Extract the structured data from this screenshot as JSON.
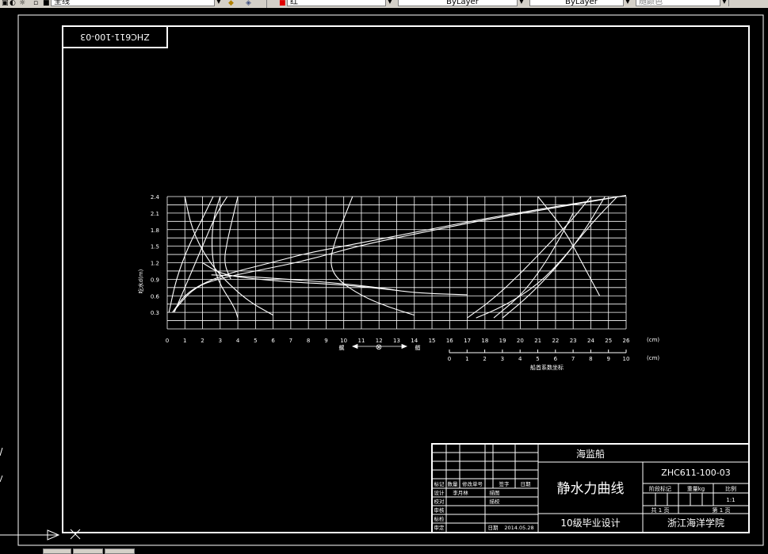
{
  "toolbar": {
    "layer_name": "全线",
    "color_name": "红",
    "linetype": "ByLayer",
    "lineweight": "ByLayer",
    "plotstyle": "随颜色"
  },
  "drawing": {
    "drawing_number_mirrored": "ZHC611-100-03",
    "chart_x_unit": "(cm)",
    "chart_x2_title": "船首系数坐标",
    "chart_y_label": "吃水d(m)",
    "left_arrow_label": "艉",
    "right_arrow_label": "艏",
    "center_symbol": "⊗",
    "title_block": {
      "ship_name": "海监船",
      "drawing_title": "静水力曲线",
      "project": "10级毕业设计",
      "drawing_number": "ZHC611-100-03",
      "school": "浙江海洋学院",
      "stage_label": "阶段标记",
      "weight_label": "重量kg",
      "scale_label": "比例",
      "scale_value": "1:1",
      "sheet_total": "共 1 页",
      "sheet_no": "第 1 页",
      "mark_label": "标记",
      "count_label": "数量",
      "change_doc_label": "修改单号",
      "sign_label": "签字",
      "date_label": "日期",
      "roles": [
        "设计",
        "校对",
        "审核",
        "标检",
        "审定"
      ],
      "designer": "李月林",
      "role_extra": [
        "描图",
        "描校"
      ],
      "date_value": "2014.05.28"
    }
  },
  "chart_data": {
    "type": "line",
    "title": "",
    "ylabel": "吃水d(m)",
    "xlabel": "(cm)",
    "x_ticks": [
      "0",
      "1",
      "2",
      "3",
      "4",
      "5",
      "6",
      "7",
      "8",
      "9",
      "10",
      "11",
      "12",
      "13",
      "14",
      "15",
      "16",
      "17",
      "18",
      "19",
      "20",
      "21",
      "22",
      "23",
      "24",
      "25",
      "26"
    ],
    "y_ticks": [
      "0.3",
      "0.6",
      "0.9",
      "1.2",
      "1.5",
      "1.8",
      "2.1",
      "2.4"
    ],
    "x2_ticks": [
      "0",
      "1",
      "2",
      "3",
      "4",
      "5",
      "6",
      "7",
      "8",
      "9",
      "10"
    ],
    "xlim": [
      0,
      26
    ],
    "ylim": [
      0,
      2.4
    ],
    "x2lim": [
      0,
      10
    ],
    "grid": true,
    "series": [
      {
        "values_x": [
          0.3,
          1.0,
          2.0,
          3.0,
          4.0,
          6.0,
          8.0,
          10.0,
          14.0,
          18.0,
          22.0,
          26.0
        ],
        "values_y": [
          0.3,
          0.62,
          0.82,
          0.95,
          1.05,
          1.21,
          1.38,
          1.5,
          1.75,
          2.0,
          2.22,
          2.42
        ]
      },
      {
        "values_x": [
          0.3,
          1.5,
          3.0,
          5.0,
          8.0,
          11.0,
          14.0,
          18.0,
          22.0,
          26.0
        ],
        "values_y": [
          0.3,
          0.75,
          0.92,
          1.05,
          1.25,
          1.52,
          1.72,
          1.98,
          2.2,
          2.42
        ]
      },
      {
        "values_x": [
          2.5,
          4.0,
          6.0,
          9.0,
          12.0,
          14.0,
          17.0
        ],
        "values_y": [
          0.98,
          0.96,
          0.92,
          0.85,
          0.75,
          0.65,
          0.62
        ]
      },
      {
        "values_x": [
          2.0,
          3.0,
          4.5,
          7.0,
          10.0,
          13.0
        ],
        "values_y": [
          1.2,
          1.0,
          0.92,
          0.85,
          0.8,
          0.7
        ]
      },
      {
        "values_x": [
          10.5,
          10.0,
          9.5,
          9.2,
          9.6,
          11.0,
          12.5,
          14.0
        ],
        "values_y": [
          2.4,
          2.0,
          1.6,
          1.2,
          0.9,
          0.6,
          0.4,
          0.25
        ]
      },
      {
        "values_x": [
          0.1,
          0.5,
          1.2,
          2.0,
          2.6
        ],
        "values_y": [
          0.3,
          0.9,
          1.5,
          2.0,
          2.4
        ]
      },
      {
        "values_x": [
          0.4,
          1.2,
          2.0,
          2.8,
          3.4
        ],
        "values_y": [
          0.3,
          0.9,
          1.5,
          2.1,
          2.4
        ]
      },
      {
        "values_x": [
          3.0,
          2.6,
          2.5,
          2.8,
          3.8,
          4.0
        ],
        "values_y": [
          2.4,
          2.0,
          1.4,
          0.9,
          0.4,
          0.2
        ]
      },
      {
        "values_x": [
          1.0,
          1.4,
          2.2,
          3.2,
          4.6,
          6.0
        ],
        "values_y": [
          2.4,
          1.8,
          1.3,
          0.9,
          0.5,
          0.25
        ]
      },
      {
        "values_x": [
          4.0,
          3.7,
          3.4,
          3.2,
          3.6
        ],
        "values_y": [
          2.4,
          2.0,
          1.6,
          1.2,
          0.9
        ]
      },
      {
        "values_x": [
          17.0,
          18.5,
          20.0,
          21.5,
          23.0,
          24.0
        ],
        "values_y": [
          0.2,
          0.55,
          1.0,
          1.5,
          2.0,
          2.4
        ]
      },
      {
        "values_x": [
          17.5,
          19.0,
          21.0,
          22.5,
          24.0,
          25.5
        ],
        "values_y": [
          0.2,
          0.4,
          0.8,
          1.3,
          1.9,
          2.4
        ]
      },
      {
        "values_x": [
          19.0,
          20.5,
          22.0,
          23.5,
          24.8
        ],
        "values_y": [
          0.2,
          0.6,
          1.1,
          1.7,
          2.4
        ]
      },
      {
        "values_x": [
          21.0,
          22.5,
          23.5,
          24.5
        ],
        "values_y": [
          2.4,
          1.8,
          1.2,
          0.6
        ]
      },
      {
        "values_x": [
          18.5,
          20.0,
          21.0,
          22.0,
          23.0
        ],
        "values_y": [
          0.2,
          0.6,
          1.0,
          1.5,
          2.1
        ]
      }
    ]
  }
}
